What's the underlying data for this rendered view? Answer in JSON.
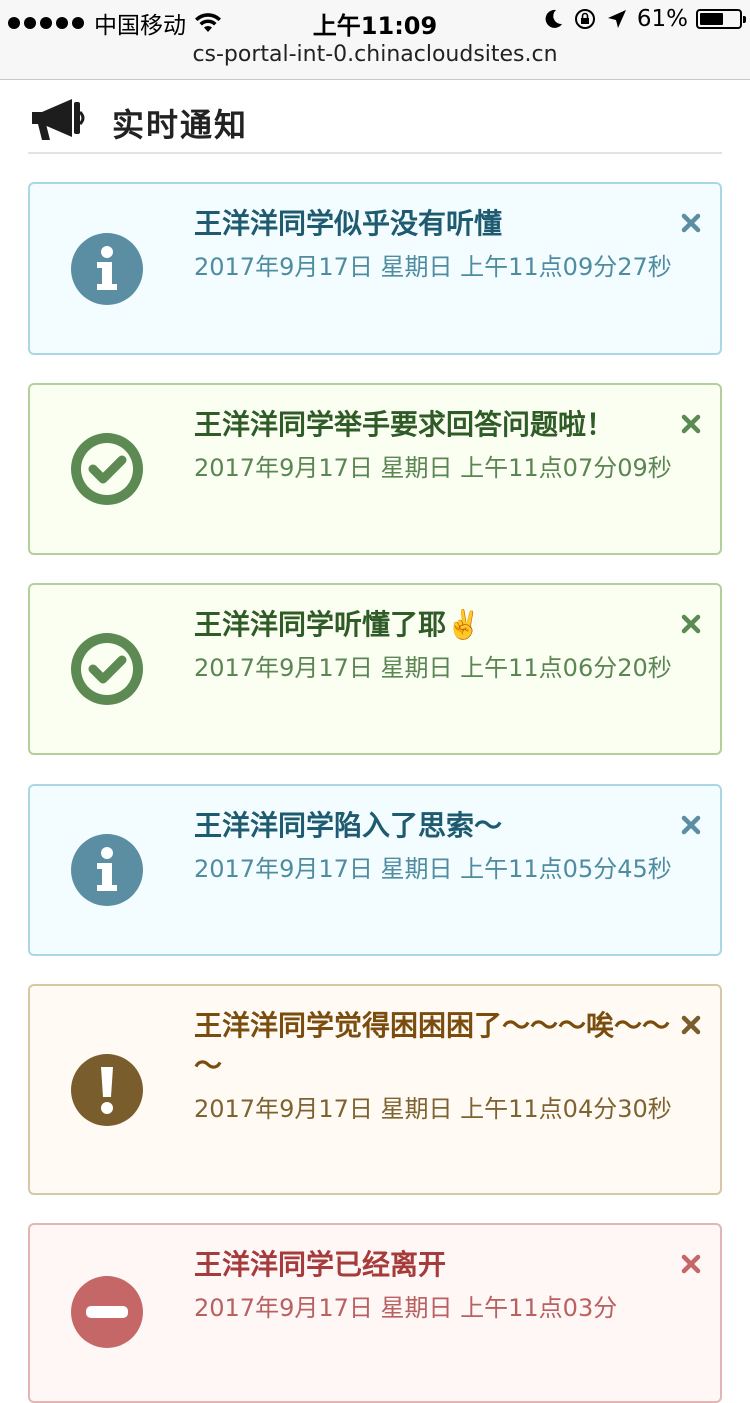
{
  "status_bar": {
    "carrier": "中国移动",
    "time": "上午11:09",
    "battery": "61%",
    "battery_level": 0.61
  },
  "browser": {
    "url": "cs-portal-int-0.chinacloudsites.cn"
  },
  "header": {
    "title": "实时通知"
  },
  "colors": {
    "info": "#5b8ea2",
    "success": "#5c8a52",
    "warning": "#7a5d2d",
    "danger": "#c66767"
  },
  "alerts": [
    {
      "type": "info",
      "icon": "info-circle-icon",
      "title": "王洋洋同学似乎没有听懂",
      "time": "2017年9月17日 星期日 上午11点09分27秒"
    },
    {
      "type": "success",
      "icon": "check-circle-icon",
      "title": "王洋洋同学举手要求回答问题啦！",
      "time": "2017年9月17日 星期日 上午11点07分09秒"
    },
    {
      "type": "success",
      "icon": "check-circle-icon",
      "title": "王洋洋同学听懂了耶✌️",
      "time": "2017年9月17日 星期日 上午11点06分20秒"
    },
    {
      "type": "info",
      "icon": "info-circle-icon",
      "title": "王洋洋同学陷入了思索～",
      "time": "2017年9月17日 星期日 上午11点05分45秒"
    },
    {
      "type": "warning",
      "icon": "exclamation-circle-icon",
      "title": "王洋洋同学觉得困困困了～～～唉～～～",
      "time": "2017年9月17日 星期日 上午11点04分30秒"
    },
    {
      "type": "danger",
      "icon": "minus-circle-icon",
      "title": "王洋洋同学已经离开",
      "time": "2017年9月17日 星期日 上午11点03分"
    }
  ]
}
